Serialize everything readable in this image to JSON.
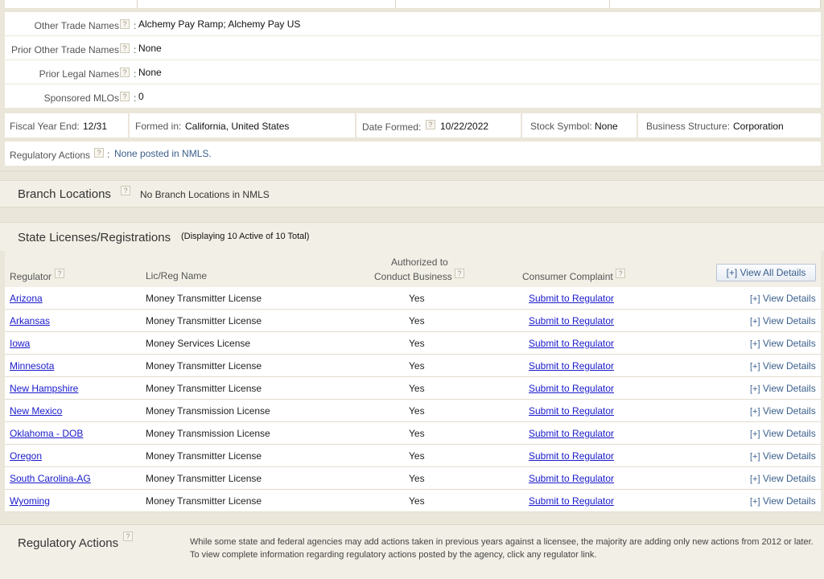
{
  "names": [
    {
      "label": "Other Trade Names",
      "value": "Alchemy Pay Ramp; Alchemy Pay US"
    },
    {
      "label": "Prior Other Trade Names",
      "value": "None"
    },
    {
      "label": "Prior Legal Names",
      "value": "None"
    },
    {
      "label": "Sponsored MLOs",
      "value": "0"
    }
  ],
  "info": {
    "fiscal_label": "Fiscal Year End:",
    "fiscal_value": "12/31",
    "formed_in_label": "Formed in:",
    "formed_in_value": "California, United States",
    "date_formed_label": "Date Formed:",
    "date_formed_value": "10/22/2022",
    "stock_label": "Stock Symbol:",
    "stock_value": "None",
    "structure_label": "Business Structure:",
    "structure_value": "Corporation"
  },
  "regulatory_row": {
    "label": "Regulatory Actions",
    "value": "None posted in NMLS."
  },
  "branch": {
    "title": "Branch Locations",
    "text": "No Branch Locations in NMLS"
  },
  "licenses": {
    "title": "State Licenses/Registrations",
    "subtitle": "(Displaying 10 Active of 10 Total)",
    "headers": {
      "regulator": "Regulator",
      "lic": "Lic/Reg Name",
      "auth_line1": "Authorized to",
      "auth_line2": "Conduct Business",
      "complaint": "Consumer Complaint"
    },
    "view_all": "[+] View All Details",
    "rows": [
      {
        "regulator": "Arizona",
        "lic": "Money Transmitter License",
        "auth": "Yes",
        "complaint": "Submit to Regulator",
        "details": "View Details"
      },
      {
        "regulator": "Arkansas",
        "lic": "Money Transmitter License",
        "auth": "Yes",
        "complaint": "Submit to Regulator",
        "details": "View Details"
      },
      {
        "regulator": "Iowa",
        "lic": "Money Services License",
        "auth": "Yes",
        "complaint": "Submit to Regulator",
        "details": "View Details"
      },
      {
        "regulator": "Minnesota",
        "lic": "Money Transmitter License",
        "auth": "Yes",
        "complaint": "Submit to Regulator",
        "details": "View Details"
      },
      {
        "regulator": "New Hampshire",
        "lic": "Money Transmitter License",
        "auth": "Yes",
        "complaint": "Submit to Regulator",
        "details": "View Details"
      },
      {
        "regulator": "New Mexico",
        "lic": "Money Transmission License",
        "auth": "Yes",
        "complaint": "Submit to Regulator",
        "details": "View Details"
      },
      {
        "regulator": "Oklahoma - DOB",
        "lic": "Money Transmission License",
        "auth": "Yes",
        "complaint": "Submit to Regulator",
        "details": "View Details"
      },
      {
        "regulator": "Oregon",
        "lic": "Money Transmitter License",
        "auth": "Yes",
        "complaint": "Submit to Regulator",
        "details": "View Details"
      },
      {
        "regulator": "South Carolina-AG",
        "lic": "Money Transmitter License",
        "auth": "Yes",
        "complaint": "Submit to Regulator",
        "details": "View Details"
      },
      {
        "regulator": "Wyoming",
        "lic": "Money Transmitter License",
        "auth": "Yes",
        "complaint": "Submit to Regulator",
        "details": "View Details"
      }
    ]
  },
  "reg_actions": {
    "title": "Regulatory Actions",
    "text": "While some state and federal agencies may add actions taken in previous years against a licensee, the majority are adding only new actions from 2012 or later. To view complete information regarding regulatory actions posted by the agency, click any regulator link."
  },
  "help_icon": "?",
  "colors": {
    "link": "#1a1acc",
    "accent": "#3a5f8c",
    "panel": "#f2efe6"
  }
}
